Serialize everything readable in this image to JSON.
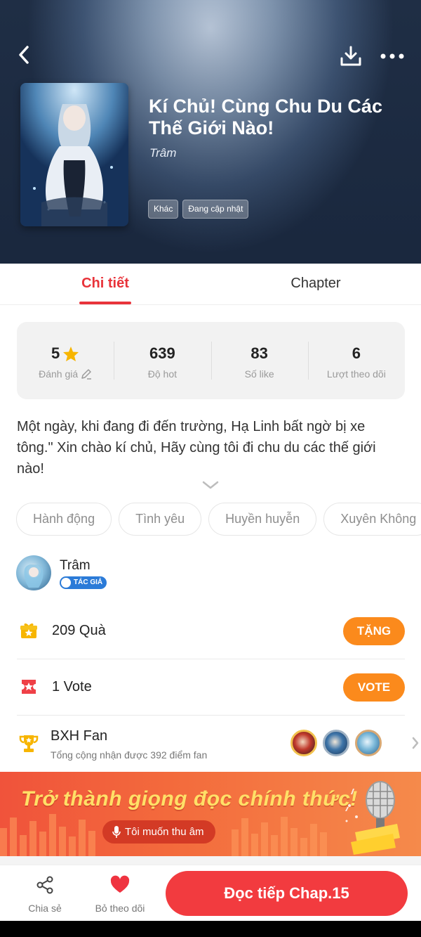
{
  "header": {
    "title": "Kí Chủ! Cùng Chu Du Các Thế Giới Nào!",
    "author": "Trâm",
    "tags": [
      "Khác",
      "Đang cập nhật"
    ]
  },
  "tabs": [
    {
      "label": "Chi tiết",
      "active": true
    },
    {
      "label": "Chapter",
      "active": false
    }
  ],
  "stats": [
    {
      "value": "5",
      "label": "Đánh giá"
    },
    {
      "value": "639",
      "label": "Độ hot"
    },
    {
      "value": "83",
      "label": "Số like"
    },
    {
      "value": "6",
      "label": "Lượt theo dõi"
    }
  ],
  "description": "Một ngày, khi đang đi đến trường, Hạ Linh bất ngờ bị xe tông.\" Xin chào kí chủ, Hãy cùng tôi đi chu du các thế giới nào!",
  "genres": [
    "Hành động",
    "Tình yêu",
    "Huyền huyễn",
    "Xuyên Không"
  ],
  "author_info": {
    "name": "Trâm",
    "badge": "TÁC GIẢ"
  },
  "gift": {
    "text": "209  Quà",
    "button": "TẶNG"
  },
  "vote": {
    "text": "1  Vote",
    "button": "VOTE"
  },
  "fan_rank": {
    "title": "BXH Fan",
    "subtitle": "Tổng cộng nhận được 392 điểm fan"
  },
  "banner": {
    "title": "Trở thành giọng đọc chính thức!",
    "button": "Tôi muốn thu âm"
  },
  "bottom": {
    "share_label": "Chia sẻ",
    "unfollow_label": "Bỏ theo dõi",
    "read_button": "Đọc tiếp Chap.15"
  },
  "colors": {
    "accent": "#e8333a",
    "orange": "#fb8a1c",
    "read_button": "#f23b3f",
    "star": "#f7b500"
  }
}
